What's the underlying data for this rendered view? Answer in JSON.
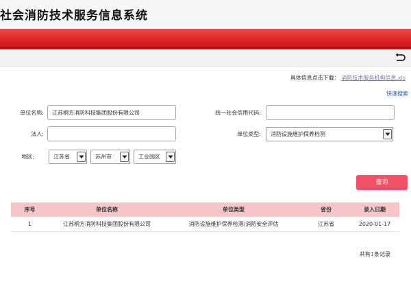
{
  "app": {
    "title": "社会消防技术服务信息系统"
  },
  "download": {
    "label": "具体信息点击下载：",
    "link_text": "消防技术服务机构信息.xls"
  },
  "quick_search": "快速搜索",
  "form": {
    "unit_name_label": "单位名称:",
    "unit_name_value": "江苏桐方消防科技集团股份有限公司",
    "credit_code_label": "统一社会信用代码:",
    "credit_code_value": "",
    "legal_person_label": "法人:",
    "legal_person_value": "",
    "unit_type_label": "单位类型:",
    "unit_type_value": "消防设施维护保养检测",
    "region_label": "地区:",
    "province": "江苏省",
    "city": "苏州市",
    "district": "工业园区"
  },
  "query_button": "查询",
  "table": {
    "headers": [
      "序号",
      "单位名称",
      "单位类型",
      "省份",
      "录入日期"
    ],
    "rows": [
      [
        "1",
        "江苏桐方消防科技集团股份有限公司",
        "消防设施维护保养检测/消防安全评估",
        "江苏省",
        "2020-01-17"
      ]
    ]
  },
  "records": {
    "prefix": "共有",
    "count": "1",
    "suffix": "条记录"
  }
}
